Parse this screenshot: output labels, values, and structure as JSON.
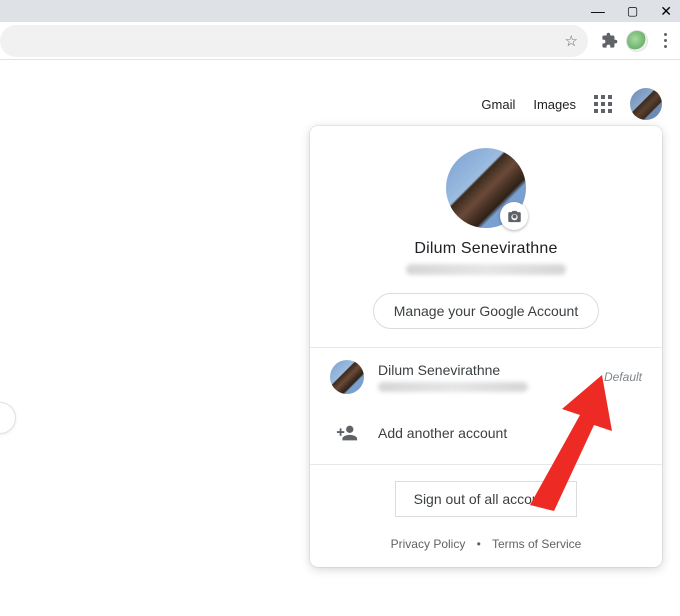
{
  "window": {
    "minimize_tip": "Minimize",
    "maximize_tip": "Maximize",
    "close_tip": "Close"
  },
  "toolbar": {
    "star_tip": "Bookmark this tab",
    "extensions_tip": "Extensions",
    "profile_tip": "Profile",
    "menu_tip": "Customize and control"
  },
  "nav": {
    "gmail": "Gmail",
    "images": "Images",
    "apps_tip": "Google apps",
    "account_tip": "Google Account"
  },
  "account_card": {
    "display_name": "Dilum Senevirathne",
    "camera_tip": "Change profile photo",
    "manage_label": "Manage your Google Account",
    "accounts": [
      {
        "name": "Dilum Senevirathne",
        "badge": "Default"
      }
    ],
    "add_account_label": "Add another account",
    "sign_out_label": "Sign out of all accounts",
    "privacy_label": "Privacy Policy",
    "terms_label": "Terms of Service"
  }
}
